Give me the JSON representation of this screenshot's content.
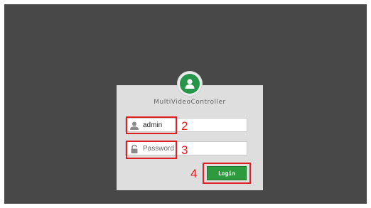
{
  "app": {
    "title": "MultiVideoController"
  },
  "login_form": {
    "username": {
      "value": "admin",
      "icon": "user-icon"
    },
    "password": {
      "placeholder": "Password",
      "icon": "lock-icon"
    },
    "login_label": "Login"
  },
  "annotations": {
    "step_username": "2",
    "step_password": "3",
    "step_login": "4"
  },
  "colors": {
    "backdrop": "#484848",
    "panel": "#dedede",
    "accent_green": "#2e9a3e",
    "annotation_red": "#e02020"
  }
}
